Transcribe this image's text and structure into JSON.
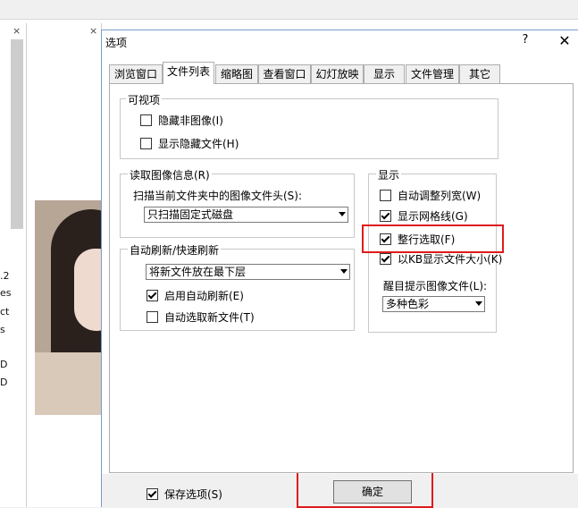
{
  "background": {
    "close_mark_1": "×",
    "close_mark_2": "×",
    "fragments": [
      ".2",
      "es",
      "ct",
      "s",
      "D",
      "D"
    ]
  },
  "dialog": {
    "title": "选项",
    "help": "?",
    "close": "✕",
    "tabs": [
      "浏览窗口",
      "文件列表",
      "缩略图",
      "查看窗口",
      "幻灯放映",
      "显示",
      "文件管理",
      "其它"
    ],
    "active_tab": "文件列表",
    "visible_group": {
      "caption": "可视项",
      "items": [
        {
          "label": "隐藏非图像(I)",
          "checked": false
        },
        {
          "label": "显示隐藏文件(H)",
          "checked": false
        }
      ]
    },
    "read_info_group": {
      "caption": "读取图像信息(R)",
      "scan_label": "扫描当前文件夹中的图像文件头(S):",
      "scan_value": "只扫描固定式磁盘"
    },
    "refresh_group": {
      "caption": "自动刷新/快速刷新",
      "position_value": "将新文件放在最下层",
      "items": [
        {
          "label": "启用自动刷新(E)",
          "checked": true
        },
        {
          "label": "自动选取新文件(T)",
          "checked": false
        }
      ]
    },
    "display_group": {
      "caption": "显示",
      "items": [
        {
          "label": "自动调整列宽(W)",
          "checked": false
        },
        {
          "label": "显示网格线(G)",
          "checked": true
        },
        {
          "label": "整行选取(F)",
          "checked": true
        },
        {
          "label": "以KB显示文件大小(K)",
          "checked": true
        }
      ],
      "hint_label": "醒目提示图像文件(L):",
      "hint_value": "多种色彩"
    },
    "footer": {
      "save_label": "保存选项(S)",
      "save_checked": true,
      "ok_label": "确定"
    }
  }
}
